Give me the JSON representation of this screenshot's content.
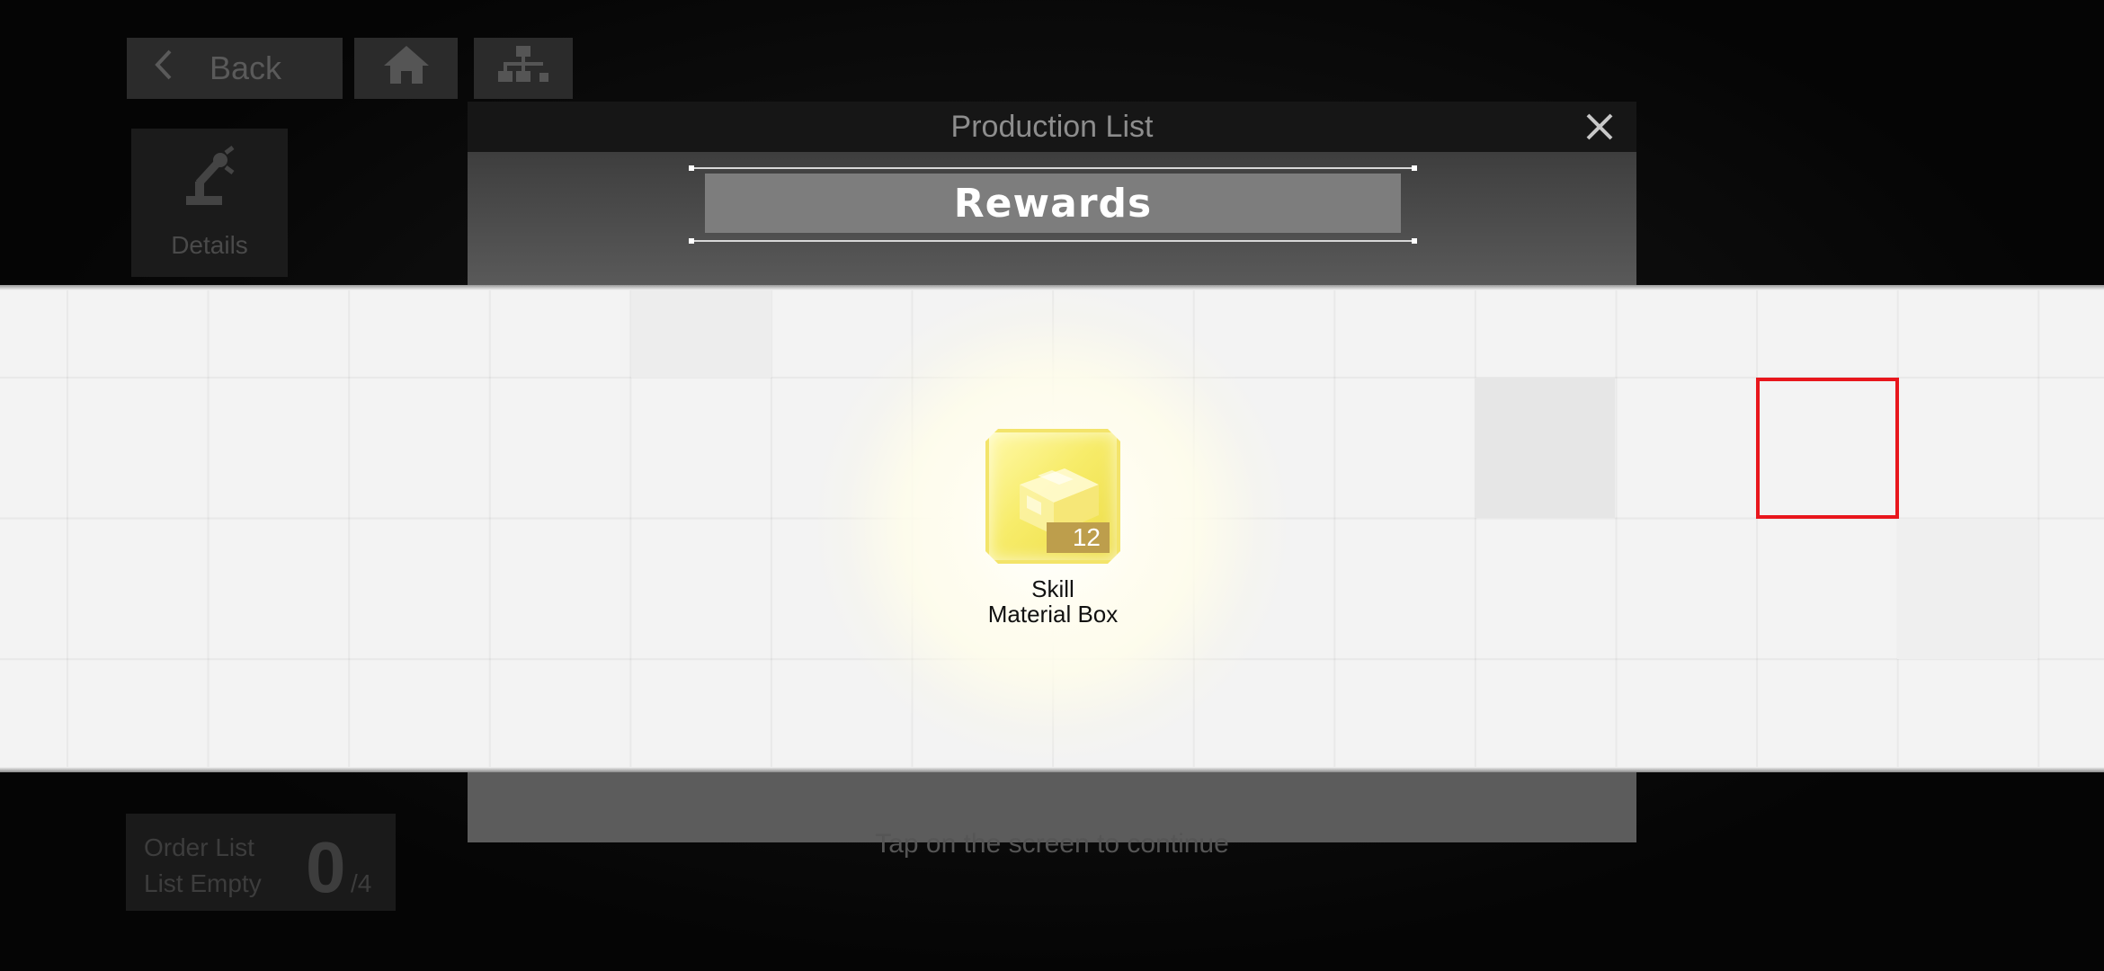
{
  "navigation": {
    "back_label": "Back",
    "home_icon": "home-icon",
    "map_icon": "hierarchy-icon"
  },
  "details_panel": {
    "label": "Details",
    "icon": "robot-arm-icon"
  },
  "order_list": {
    "title": "Order List",
    "status": "List Empty",
    "count": "0",
    "max": "/4"
  },
  "modal": {
    "title": "Production List",
    "close_icon": "close-icon",
    "banner_title": "Rewards"
  },
  "rewards": [
    {
      "name_line1": "Skill",
      "name_line2": "Material Box",
      "quantity": "12",
      "icon": "material-box-icon"
    }
  ],
  "footer": {
    "hint": "Tap on the screen to continue"
  },
  "colors": {
    "highlight_frame": "#e8161c",
    "item_gold": "#f7ec6a",
    "quantity_badge": "#bd9e4c"
  }
}
